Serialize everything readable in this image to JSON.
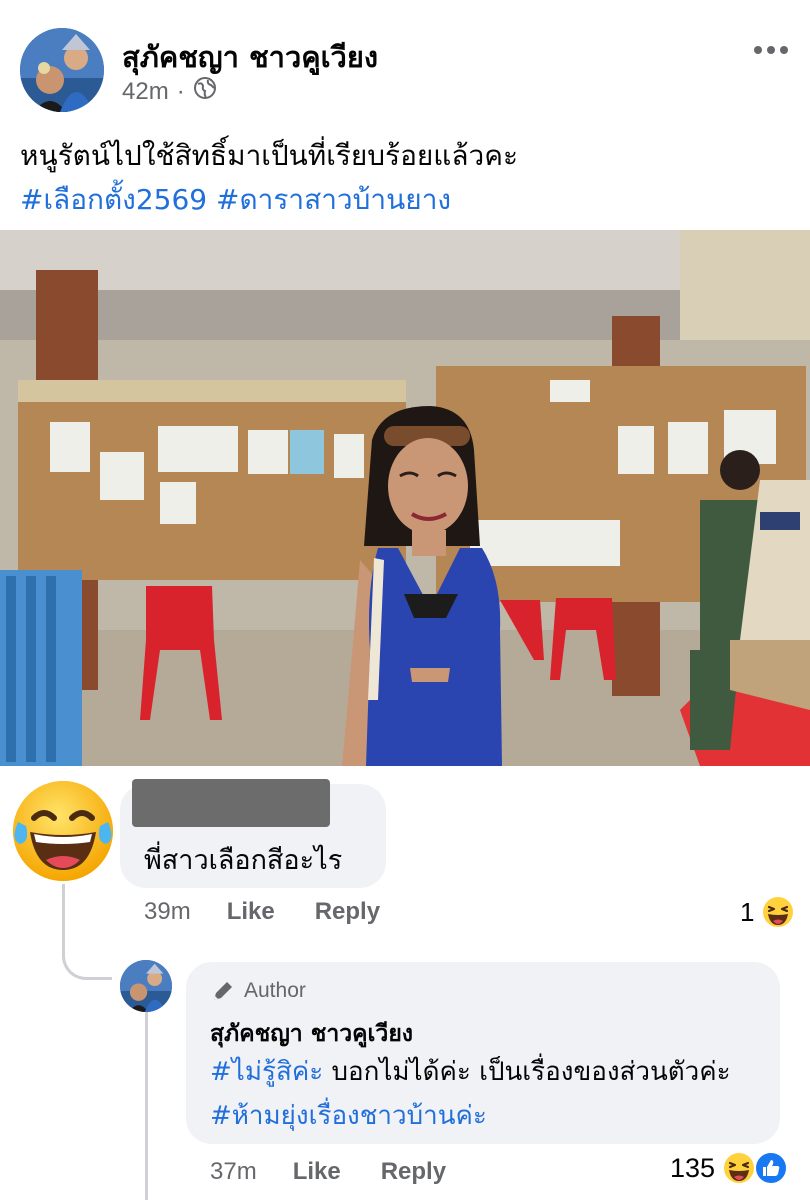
{
  "post": {
    "author_name": "สุภัคชญา ชาวคูเวียง",
    "time": "42m",
    "separator": "·",
    "privacy_icon": "globe-icon",
    "more_icon": "more-horizontal-icon",
    "text": "หนูรัตน์ไปใช้สิทธิ์มาเป็นที่เรียบร้อยแล้วคะ",
    "hashtags": [
      "#เลือกตั้ง2569",
      "#ดาราสาวบ้านยาง"
    ]
  },
  "comment": {
    "avatar_icon": "laughing-tears-emoji-icon",
    "text": "พี่สาวเลือกสีอะไร",
    "time": "39m",
    "like_label": "Like",
    "reply_label": "Reply",
    "reaction_count": "1",
    "reaction_icon": "haha-reaction-icon"
  },
  "reply": {
    "badge_icon": "pencil-icon",
    "badge_label": "Author",
    "author_name": "สุภัคชญา ชาวคูเวียง",
    "hashtag1": "#ไม่รู้สิค่ะ",
    "text_middle": " บอกไม่ได้ค่ะ เป็นเรื่องของส่วนตัวค่ะ ",
    "hashtag2": "#ห้ามยุ่งเรื่องชาวบ้านค่ะ",
    "time": "37m",
    "like_label": "Like",
    "reply_label": "Reply",
    "reaction_count": "135",
    "reaction_icons": [
      "haha-reaction-icon",
      "like-reaction-icon"
    ]
  },
  "colors": {
    "link": "#216fdb",
    "secondary_text": "#65676b",
    "bubble": "#f0f2f5",
    "like_blue": "#1877f2"
  }
}
